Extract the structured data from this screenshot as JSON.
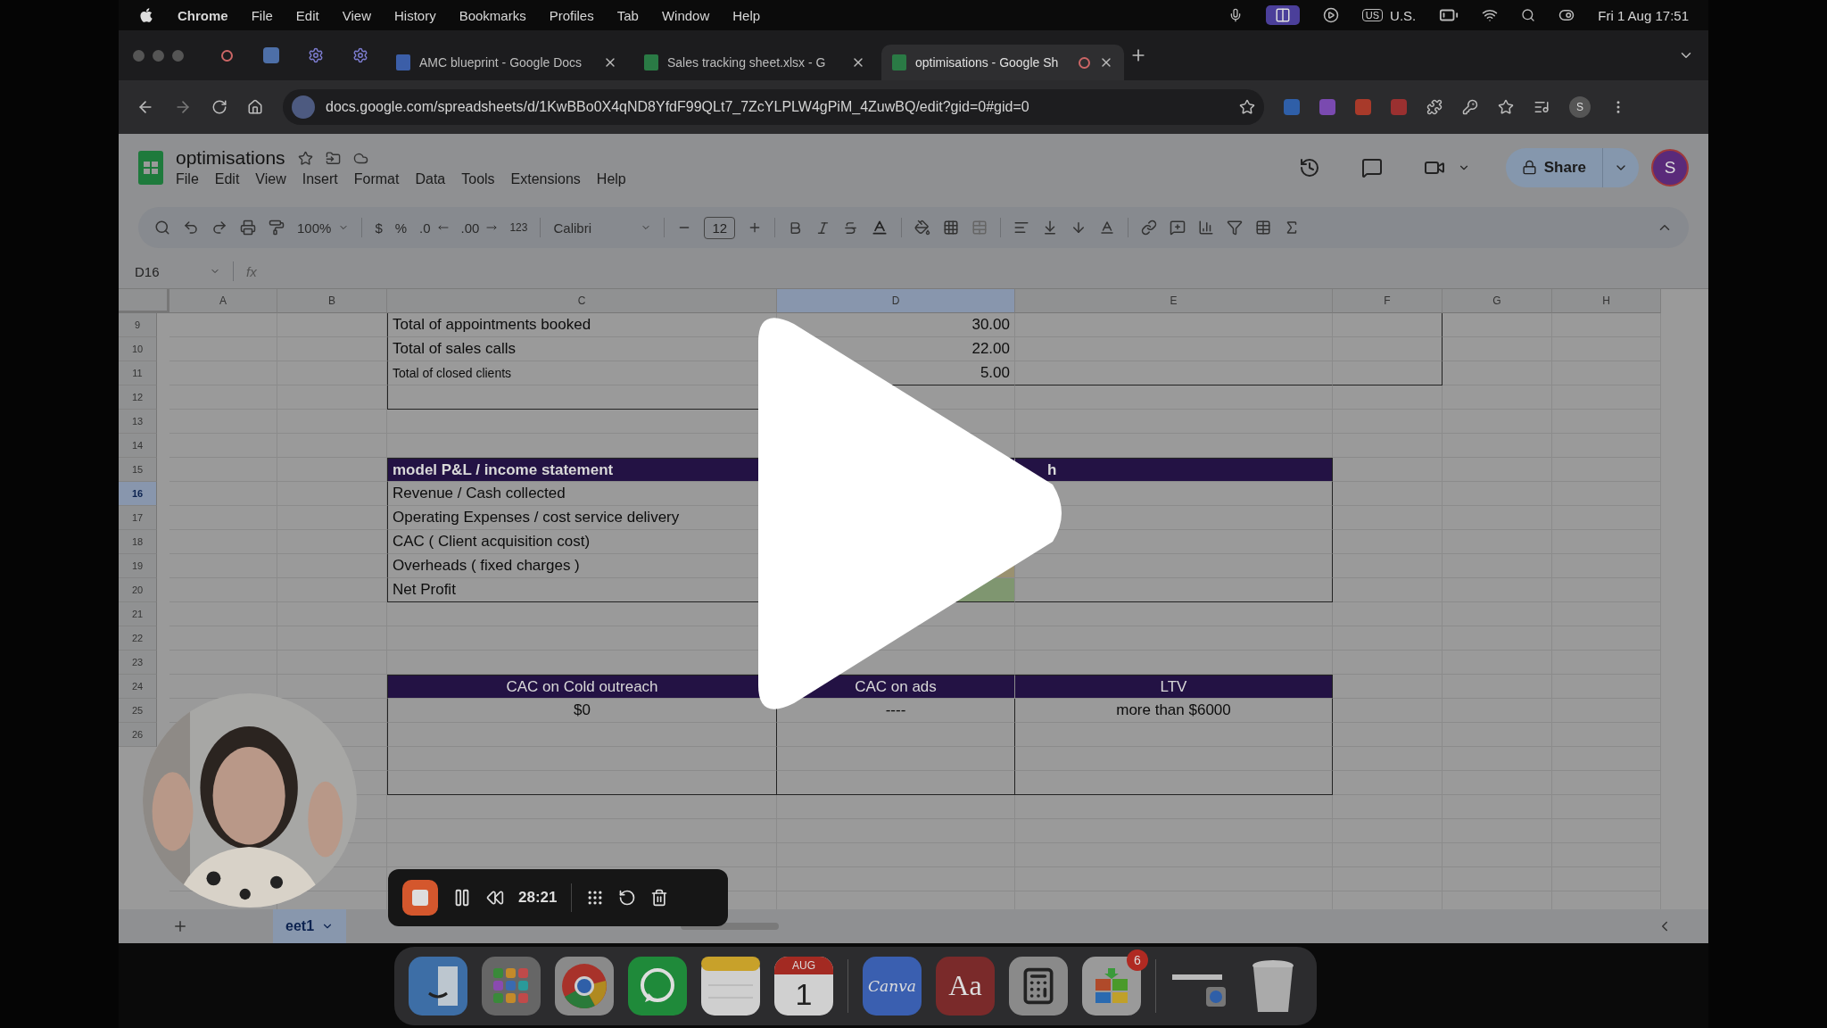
{
  "menubar": {
    "app": "Chrome",
    "menus": [
      "File",
      "Edit",
      "View",
      "History",
      "Bookmarks",
      "Profiles",
      "Tab",
      "Window",
      "Help"
    ],
    "input_badge": "US",
    "input_source": "U.S.",
    "clock": "Fri 1 Aug  17:51"
  },
  "browser": {
    "tabs": [
      {
        "kind": "pinned",
        "selected": false
      },
      {
        "kind": "pinned",
        "selected": false
      },
      {
        "kind": "pinned",
        "selected": false
      },
      {
        "kind": "pinned",
        "selected": false
      },
      {
        "kind": "docs",
        "title": "AMC blueprint - Google Docs",
        "selected": false
      },
      {
        "kind": "sheets",
        "title": "Sales tracking sheet.xlsx - G",
        "selected": false
      },
      {
        "kind": "sheets",
        "title": "optimisations - Google Sh",
        "selected": true
      }
    ],
    "url": "docs.google.com/spreadsheets/d/1KwBBo0X4qND8YfdF99QLt7_7ZcYLPLW4gPiM_4ZuwBQ/edit?gid=0#gid=0",
    "avatar": "S"
  },
  "sheets": {
    "title": "optimisations",
    "menus": [
      "File",
      "Edit",
      "View",
      "Insert",
      "Format",
      "Data",
      "Tools",
      "Extensions",
      "Help"
    ],
    "share": "Share",
    "avatar": "S",
    "toolbar": {
      "zoom": "100%",
      "currency": "$",
      "percent": "%",
      "dec_less": ".0",
      "dec_more": ".00",
      "format": "123",
      "font": "Calibri",
      "size": "12"
    },
    "name_box": "D16",
    "fx": "fx",
    "columns": [
      {
        "label": "A",
        "selected": false
      },
      {
        "label": "B",
        "selected": false
      },
      {
        "label": "C",
        "selected": false
      },
      {
        "label": "D",
        "selected": true
      },
      {
        "label": "E",
        "selected": false
      },
      {
        "label": "F",
        "selected": false
      },
      {
        "label": "G",
        "selected": false
      },
      {
        "label": "H",
        "selected": false
      }
    ],
    "rows": [
      {
        "num": "9",
        "kind": "box",
        "small": false,
        "c": "Total of appointments booked",
        "d": "30.00",
        "selected": false
      },
      {
        "num": "10",
        "kind": "box",
        "small": false,
        "c": "Total of sales calls",
        "d": "22.00",
        "selected": false
      },
      {
        "num": "11",
        "kind": "box-end",
        "small": true,
        "c": "Total of closed clients",
        "d": "5.00",
        "selected": false
      },
      {
        "num": "12",
        "kind": "box-tail",
        "selected": false
      },
      {
        "num": "13",
        "kind": "empty",
        "selected": false
      },
      {
        "num": "14",
        "kind": "empty",
        "selected": false
      },
      {
        "num": "15",
        "kind": "pl-head",
        "c": "model P&L / income statement",
        "e": "h",
        "selected": false
      },
      {
        "num": "16",
        "kind": "pl",
        "c": "Revenue / Cash collected",
        "selected": true
      },
      {
        "num": "17",
        "kind": "pl",
        "c": "Operating Expenses / cost service delivery",
        "selected": false
      },
      {
        "num": "18",
        "kind": "pl",
        "c": "CAC ( Client acquisition cost)",
        "selected": false
      },
      {
        "num": "19",
        "kind": "pl",
        "c": "Overheads ( fixed charges )",
        "color": "#9a9170",
        "selected": false
      },
      {
        "num": "20",
        "kind": "pl-end",
        "c": "Net Profit",
        "color": "#7f9670",
        "selected": false
      },
      {
        "num": "21",
        "kind": "empty",
        "selected": false
      },
      {
        "num": "22",
        "kind": "empty",
        "selected": false
      },
      {
        "num": "23",
        "kind": "empty",
        "selected": false
      },
      {
        "num": "24",
        "kind": "kpi-head",
        "c": "CAC on Cold outreach",
        "d": "CAC on ads",
        "e": "LTV",
        "selected": false
      },
      {
        "num": "25",
        "kind": "kpi",
        "c": "$0",
        "d": "----",
        "e": "more than $6000",
        "selected": false
      },
      {
        "num": "26",
        "kind": "kpi",
        "selected": false
      },
      {
        "kind": "kpi"
      },
      {
        "kind": "kpi-end"
      },
      {
        "kind": "empty"
      },
      {
        "kind": "empty"
      },
      {
        "kind": "empty"
      },
      {
        "kind": "empty"
      },
      {
        "kind": "empty"
      }
    ],
    "sheet_tab": "eet1"
  },
  "recorder": {
    "time": "28:21"
  },
  "dock": [
    {
      "kind": "finder"
    },
    {
      "kind": "launchpad"
    },
    {
      "kind": "chrome"
    },
    {
      "kind": "whatsapp"
    },
    {
      "kind": "notes"
    },
    {
      "kind": "calendar",
      "month": "AUG",
      "day": "1"
    },
    {
      "kind": "divider"
    },
    {
      "kind": "canva",
      "label": "Canva"
    },
    {
      "kind": "dictionary",
      "label": "Aa"
    },
    {
      "kind": "calculator"
    },
    {
      "kind": "store",
      "badge": "6"
    },
    {
      "kind": "divider"
    },
    {
      "kind": "window"
    },
    {
      "kind": "trash"
    }
  ]
}
